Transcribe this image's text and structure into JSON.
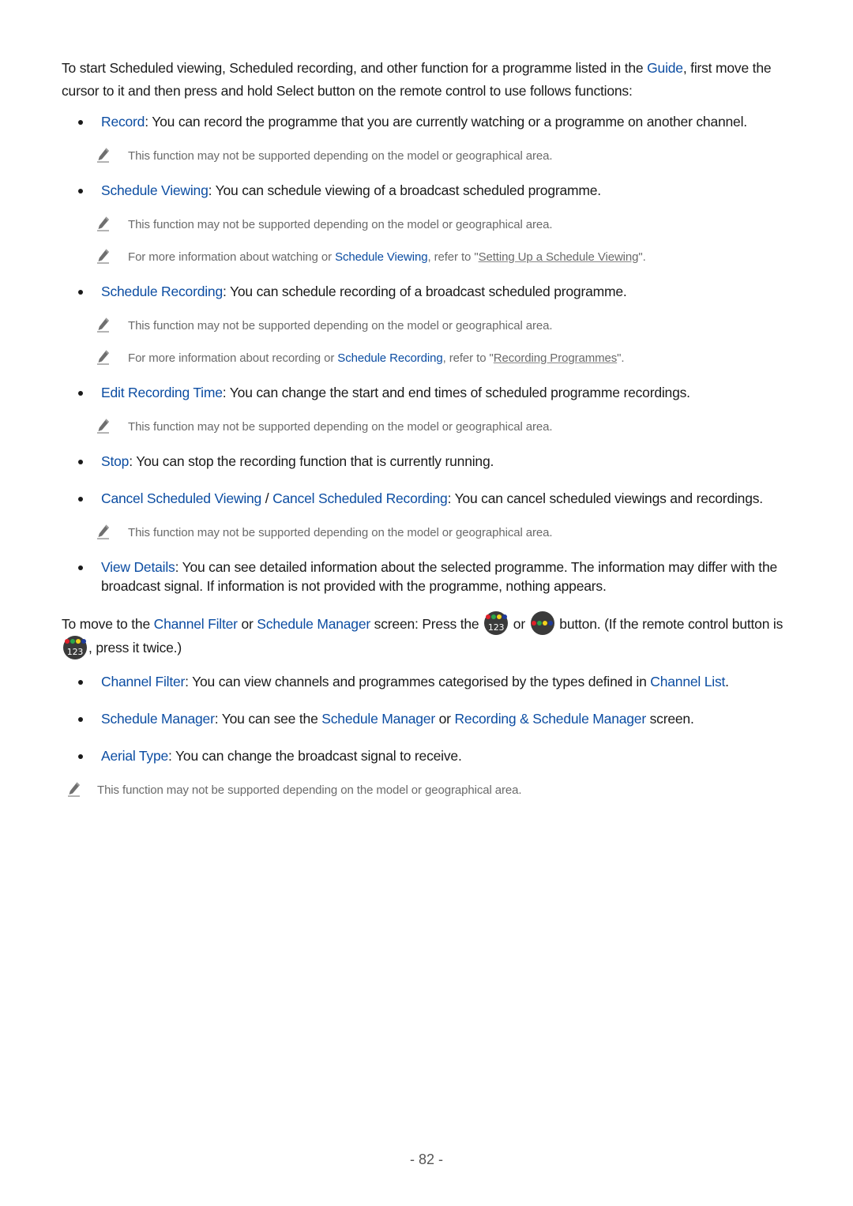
{
  "intro": {
    "text_before": "To start Scheduled viewing, Scheduled recording, and other function for a programme listed in the ",
    "link": "Guide",
    "text_after": ", first move the cursor to it and then press and hold Select button on the remote control to use follows functions:"
  },
  "functions": [
    {
      "term": "Record",
      "desc": ": You can record the programme that you are currently watching or a programme on another channel.",
      "notes": [
        {
          "text": "This function may not be supported depending on the model or geographical area."
        }
      ]
    },
    {
      "term": "Schedule Viewing",
      "desc": ": You can schedule viewing of a broadcast scheduled programme.",
      "notes": [
        {
          "text": "This function may not be supported depending on the model or geographical area."
        },
        {
          "pre": "For more information about watching or ",
          "link": "Schedule Viewing",
          "mid": ", refer to \"",
          "ref": "Setting Up a Schedule Viewing",
          "post": "\"."
        }
      ]
    },
    {
      "term": "Schedule Recording",
      "desc": ": You can schedule recording of a broadcast scheduled programme.",
      "notes": [
        {
          "text": "This function may not be supported depending on the model or geographical area."
        },
        {
          "pre": "For more information about recording or ",
          "link": "Schedule Recording",
          "mid": ", refer to \"",
          "ref": "Recording Programmes",
          "post": "\"."
        }
      ]
    },
    {
      "term": "Edit Recording Time",
      "desc": ": You can change the start and end times of scheduled programme recordings.",
      "notes": [
        {
          "text": "This function may not be supported depending on the model or geographical area."
        }
      ]
    },
    {
      "term": "Stop",
      "desc": ": You can stop the recording function that is currently running.",
      "notes": []
    },
    {
      "term": "Cancel Scheduled Viewing",
      "separator": " / ",
      "term2": "Cancel Scheduled Recording",
      "desc": ": You can cancel scheduled viewings and recordings.",
      "notes": [
        {
          "text": "This function may not be supported depending on the model or geographical area."
        }
      ]
    },
    {
      "term": "View Details",
      "desc": ": You can see detailed information about the selected programme. The information may differ with the broadcast signal. If information is not provided with the programme, nothing appears.",
      "notes": []
    }
  ],
  "move": {
    "t1": "To move to the ",
    "link1": "Channel Filter",
    "t2": " or ",
    "link2": "Schedule Manager",
    "t3": " screen: Press the ",
    "t4": " or ",
    "t5": " button. (If the remote control button is ",
    "t6": ", press it twice.)",
    "button_num_label": "123",
    "colors": {
      "red": "#e0202a",
      "green": "#2aa84a",
      "yellow": "#f2d21c",
      "blue": "#1e3a9a"
    }
  },
  "sub_functions": [
    {
      "term": "Channel Filter",
      "desc": ": You can view channels and programmes categorised by the types defined in ",
      "link": "Channel List",
      "post": "."
    },
    {
      "term": "Schedule Manager",
      "desc": ": You can see the ",
      "link": "Schedule Manager",
      "mid": " or ",
      "link2": "Recording & Schedule Manager",
      "post": " screen."
    },
    {
      "term": "Aerial Type",
      "desc": ": You can change the broadcast signal to receive."
    }
  ],
  "final_note": "This function may not be supported depending on the model or geographical area.",
  "page_number": "- 82 -",
  "colors": {
    "link": "#0c4da2",
    "text": "#1a1a1a",
    "note": "#6a6a6a"
  }
}
